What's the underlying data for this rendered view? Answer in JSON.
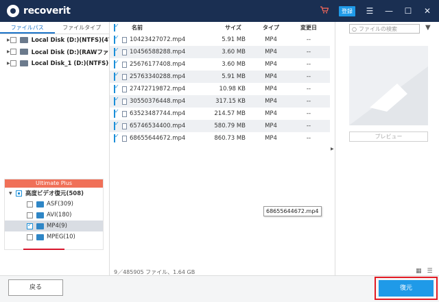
{
  "app": {
    "title": "recoverit"
  },
  "titlebar": {
    "register_label": "登録",
    "cart_icon": "cart-icon",
    "menu_icon": "hamburger-icon"
  },
  "left_tabs": [
    "ファイルパス",
    "ファイルタイプ"
  ],
  "disks": [
    {
      "label": "Local Disk (D:)(NTFS)(47…"
    },
    {
      "label": "Local Disk (D:)(RAWファイル…"
    },
    {
      "label": "Local Disk_1 (D:)(NTFS)(1…"
    }
  ],
  "advanced": {
    "banner": "Ultimate Plus",
    "root_label": "高度ビデオ復元(508)",
    "items": [
      {
        "label": "ASF(309)",
        "checked": false
      },
      {
        "label": "AVI(180)",
        "checked": false
      },
      {
        "label": "MP4(9)",
        "checked": true
      },
      {
        "label": "MPEG(10)",
        "checked": false
      }
    ]
  },
  "grid": {
    "headers": {
      "name": "名前",
      "size": "サイズ",
      "type": "タイプ",
      "date": "変更日"
    },
    "rows": [
      {
        "name": "10423427072.mp4",
        "size": "5.91  MB",
        "type": "MP4",
        "date": "--"
      },
      {
        "name": "10456588288.mp4",
        "size": "3.60  MB",
        "type": "MP4",
        "date": "--"
      },
      {
        "name": "25676177408.mp4",
        "size": "3.60  MB",
        "type": "MP4",
        "date": "--"
      },
      {
        "name": "25763340288.mp4",
        "size": "5.91  MB",
        "type": "MP4",
        "date": "--"
      },
      {
        "name": "27472719872.mp4",
        "size": "10.98  KB",
        "type": "MP4",
        "date": "--"
      },
      {
        "name": "30550376448.mp4",
        "size": "317.15  KB",
        "type": "MP4",
        "date": "--"
      },
      {
        "name": "63523487744.mp4",
        "size": "214.57  MB",
        "type": "MP4",
        "date": "--"
      },
      {
        "name": "65746534400.mp4",
        "size": "580.79  MB",
        "type": "MP4",
        "date": "--"
      },
      {
        "name": "68655644672.mp4",
        "size": "860.73  MB",
        "type": "MP4",
        "date": "--"
      }
    ],
    "tooltip": "68655644672.mp4"
  },
  "search": {
    "placeholder": "ファイルの検索"
  },
  "preview": {
    "button_label": "プレビュー"
  },
  "status": {
    "text": "9／485905 ファイル、1.64  GB"
  },
  "bottom": {
    "back_label": "戻る",
    "restore_label": "復元"
  }
}
